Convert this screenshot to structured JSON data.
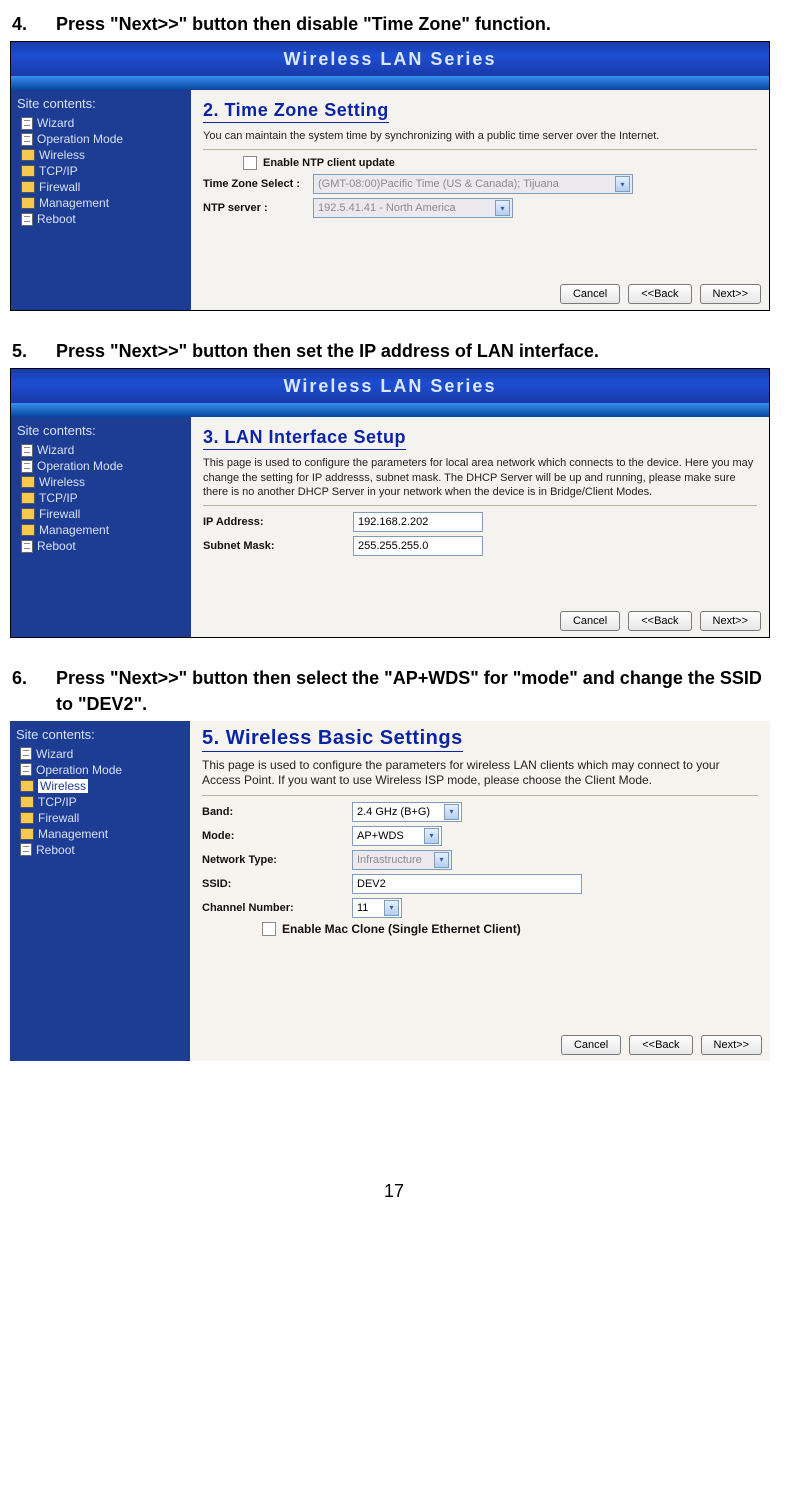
{
  "page_number": "17",
  "banner_title": "Wireless LAN Series",
  "sidebar_title": "Site contents:",
  "sidebar_items": [
    "Wizard",
    "Operation Mode",
    "Wireless",
    "TCP/IP",
    "Firewall",
    "Management",
    "Reboot"
  ],
  "step4": {
    "num": "4.",
    "text": "Press \"Next>>\" button then disable \"Time Zone\" function.",
    "title": "2. Time Zone Setting",
    "desc": "You can maintain the system time by synchronizing with a public time server over the Internet.",
    "enable_label": "Enable NTP client update",
    "tz_label": "Time Zone Select :",
    "tz_value": "(GMT-08:00)Pacific Time (US & Canada); Tijuana",
    "ntp_label": "NTP server :",
    "ntp_value": "192.5.41.41 - North America"
  },
  "step5": {
    "num": "5.",
    "text": "Press \"Next>>\" button then set the IP address of LAN interface.",
    "title": "3. LAN Interface Setup",
    "desc": "This page is used to configure the parameters for local area network which connects to the device. Here you may change the setting for IP addresss, subnet mask. The DHCP Server will be up and running, please make sure there is no another DHCP Server in your network when the device is in Bridge/Client Modes.",
    "ip_label": "IP Address:",
    "ip_value": "192.168.2.202",
    "mask_label": "Subnet Mask:",
    "mask_value": "255.255.255.0"
  },
  "step6": {
    "num": "6.",
    "text": "Press \"Next>>\" button then select the \"AP+WDS\" for \"mode\" and change the SSID to \"DEV2\".",
    "title": "5. Wireless Basic Settings",
    "desc": "This page is used to configure the parameters for wireless LAN clients which may connect to your Access Point. If you want to use Wireless ISP mode, please choose the Client Mode.",
    "band_label": "Band:",
    "band_value": "2.4 GHz (B+G)",
    "mode_label": "Mode:",
    "mode_value": "AP+WDS",
    "nettype_label": "Network Type:",
    "nettype_value": "Infrastructure",
    "ssid_label": "SSID:",
    "ssid_value": "DEV2",
    "channel_label": "Channel Number:",
    "channel_value": "11",
    "mac_label": "Enable Mac Clone (Single Ethernet Client)"
  },
  "buttons": {
    "cancel": "Cancel",
    "back": "<<Back",
    "next": "Next>>"
  }
}
